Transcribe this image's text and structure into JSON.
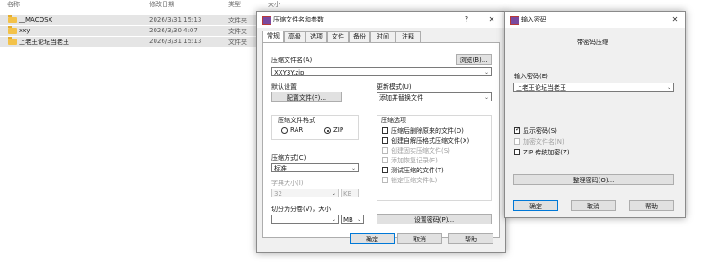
{
  "explorer": {
    "columns": {
      "name": "名称",
      "date": "修改日期",
      "type": "类型",
      "size": "大小"
    },
    "files": [
      {
        "name": "__MACOSX",
        "date": "2026/3/31 15:13",
        "type": "文件夹"
      },
      {
        "name": "xxy",
        "date": "2026/3/30 4:07",
        "type": "文件夹"
      },
      {
        "name": "上老王论坛当老王",
        "date": "2026/3/31 15:13",
        "type": "文件夹"
      }
    ]
  },
  "archive_dialog": {
    "title": "压缩文件名和参数",
    "help_glyph": "?",
    "close_glyph": "✕",
    "tabs": [
      "常规",
      "高级",
      "选项",
      "文件",
      "备份",
      "时间",
      "注释"
    ],
    "archive_name_label": "压缩文件名(A)",
    "browse_label": "浏览(B)...",
    "archive_name_value": "XXY3Y.zip",
    "default_settings_label": "默认设置",
    "profiles_button": "配置文件(F)...",
    "update_mode_label": "更新模式(U)",
    "update_mode_value": "添加并替换文件",
    "format_group_label": "压缩文件格式",
    "format_rar": "RAR",
    "format_zip": "ZIP",
    "method_label": "压缩方式(C)",
    "method_value": "标准",
    "dict_label": "字典大小(I)",
    "dict_value": "32",
    "dict_unit": "KB",
    "split_label": "切分为分卷(V)，大小",
    "split_value": "",
    "split_unit": "MB",
    "options_group_label": "压缩选项",
    "options": [
      {
        "label": "压缩后删除原来的文件(D)",
        "checked": false,
        "enabled": true
      },
      {
        "label": "创建自解压格式压缩文件(X)",
        "checked": false,
        "enabled": true
      },
      {
        "label": "创建固实压缩文件(S)",
        "checked": false,
        "enabled": false
      },
      {
        "label": "添加恢复记录(E)",
        "checked": false,
        "enabled": false
      },
      {
        "label": "测试压缩的文件(T)",
        "checked": false,
        "enabled": true
      },
      {
        "label": "锁定压缩文件(L)",
        "checked": false,
        "enabled": false
      }
    ],
    "set_password_button": "设置密码(P)...",
    "ok_button": "确定",
    "cancel_button": "取消",
    "help_button": "帮助"
  },
  "password_dialog": {
    "title": "输入密码",
    "close_glyph": "✕",
    "heading": "带密码压缩",
    "enter_password_label": "输入密码(E)",
    "password_value": "上老王论坛当老王",
    "show_password_label": "显示密码(S)",
    "show_password_checked": true,
    "encrypt_names_label": "加密文件名(N)",
    "zip_legacy_label": "ZIP 传统加密(Z)",
    "organize_button": "整理密码(O)...",
    "ok_button": "确定",
    "cancel_button": "取消",
    "help_button": "帮助"
  },
  "colors": {
    "folder": "#f3c24a",
    "selected_row": "#e5e5e5",
    "dialog_bg": "#f0f0f0",
    "default_button_border": "#0078d7"
  }
}
